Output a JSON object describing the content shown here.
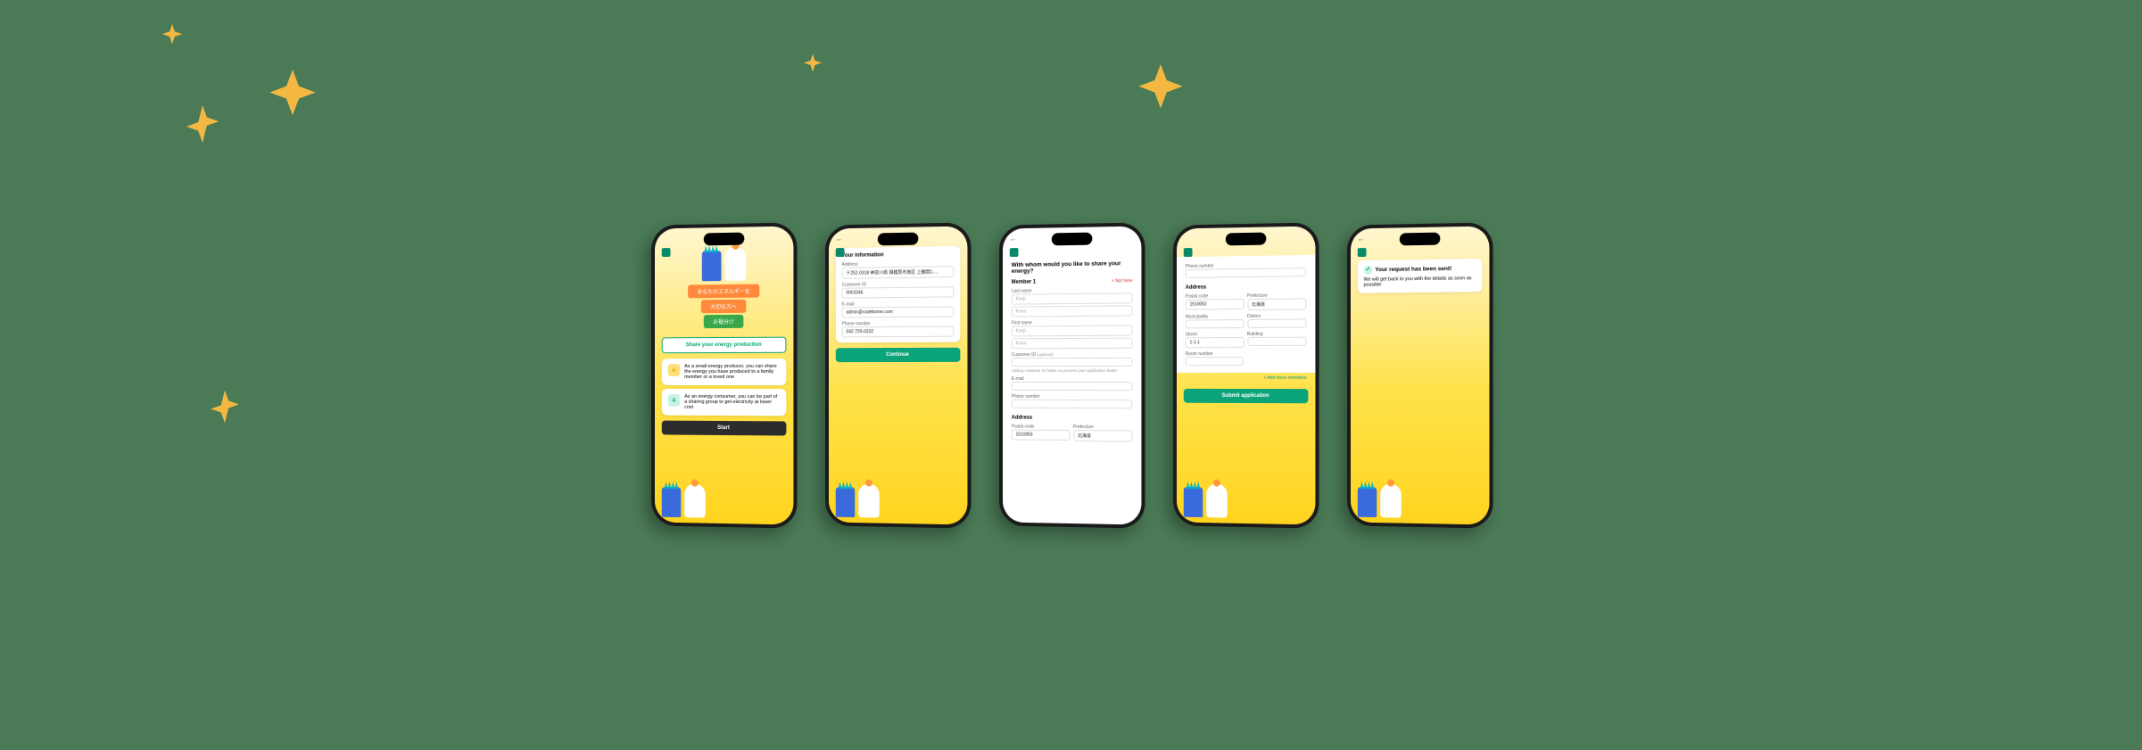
{
  "colors": {
    "accent": "#0aa478",
    "star": "#f4b842",
    "bg": "#4a7a56"
  },
  "phone1": {
    "ribbon1": "あなたのエネルギーを",
    "ribbon2": "大切な方へ",
    "ribbon3": "お裾分け",
    "share_btn": "Share your energy production",
    "info1": "As a small energy producer, you can share the energy you have produced to a family member or a loved one",
    "info2": "As an energy consumer, you can be part of a sharing group to get electricity at lower cost",
    "start_btn": "Start"
  },
  "phone2": {
    "heading": "Your information",
    "address_label": "Address",
    "address_value": "〒252-0318 神奈川県 相模原市南区 上鶴間1-…",
    "customer_id_label": "Customer ID",
    "customer_id_value": "0003345",
    "email_label": "E-mail",
    "email_value": "admin@codeborne.com",
    "phone_label": "Phone number",
    "phone_value": "042-729-0332",
    "continue_btn": "Continue"
  },
  "phone3": {
    "heading": "With whom would you like to share your energy?",
    "member1": "Member 1",
    "lastname_label": "Last name",
    "kanji": "Kanji",
    "kana": "Kana",
    "firstname_label": "First name",
    "customer_id_label": "Customer ID",
    "customer_id_optional": "(optional)",
    "hint": "Adding customer ID helps us process your application faster",
    "email_label": "E-mail",
    "phone_label": "Phone number",
    "address_heading": "Address",
    "postal_label": "Postal code",
    "prefecture_label": "Prefecture",
    "postal_value": "1510053",
    "prefecture_value": "北海道",
    "clear": "Not here"
  },
  "phone4": {
    "phone_label": "Phone number",
    "address_heading": "Address",
    "postal_label": "Postal code",
    "prefecture_label": "Prefecture",
    "postal_value": "1510053",
    "prefecture_value": "北海道",
    "municipality_label": "Municipality",
    "district_label": "District",
    "street_label": "Street",
    "street_value": "1-1-1",
    "building_label": "Building",
    "room_label": "Room number",
    "add_more": "+  Add more members",
    "submit_btn": "Submit application"
  },
  "phone5": {
    "title": "Your request has been sent!",
    "body": "We will get back to you with the details as soon as possible"
  }
}
